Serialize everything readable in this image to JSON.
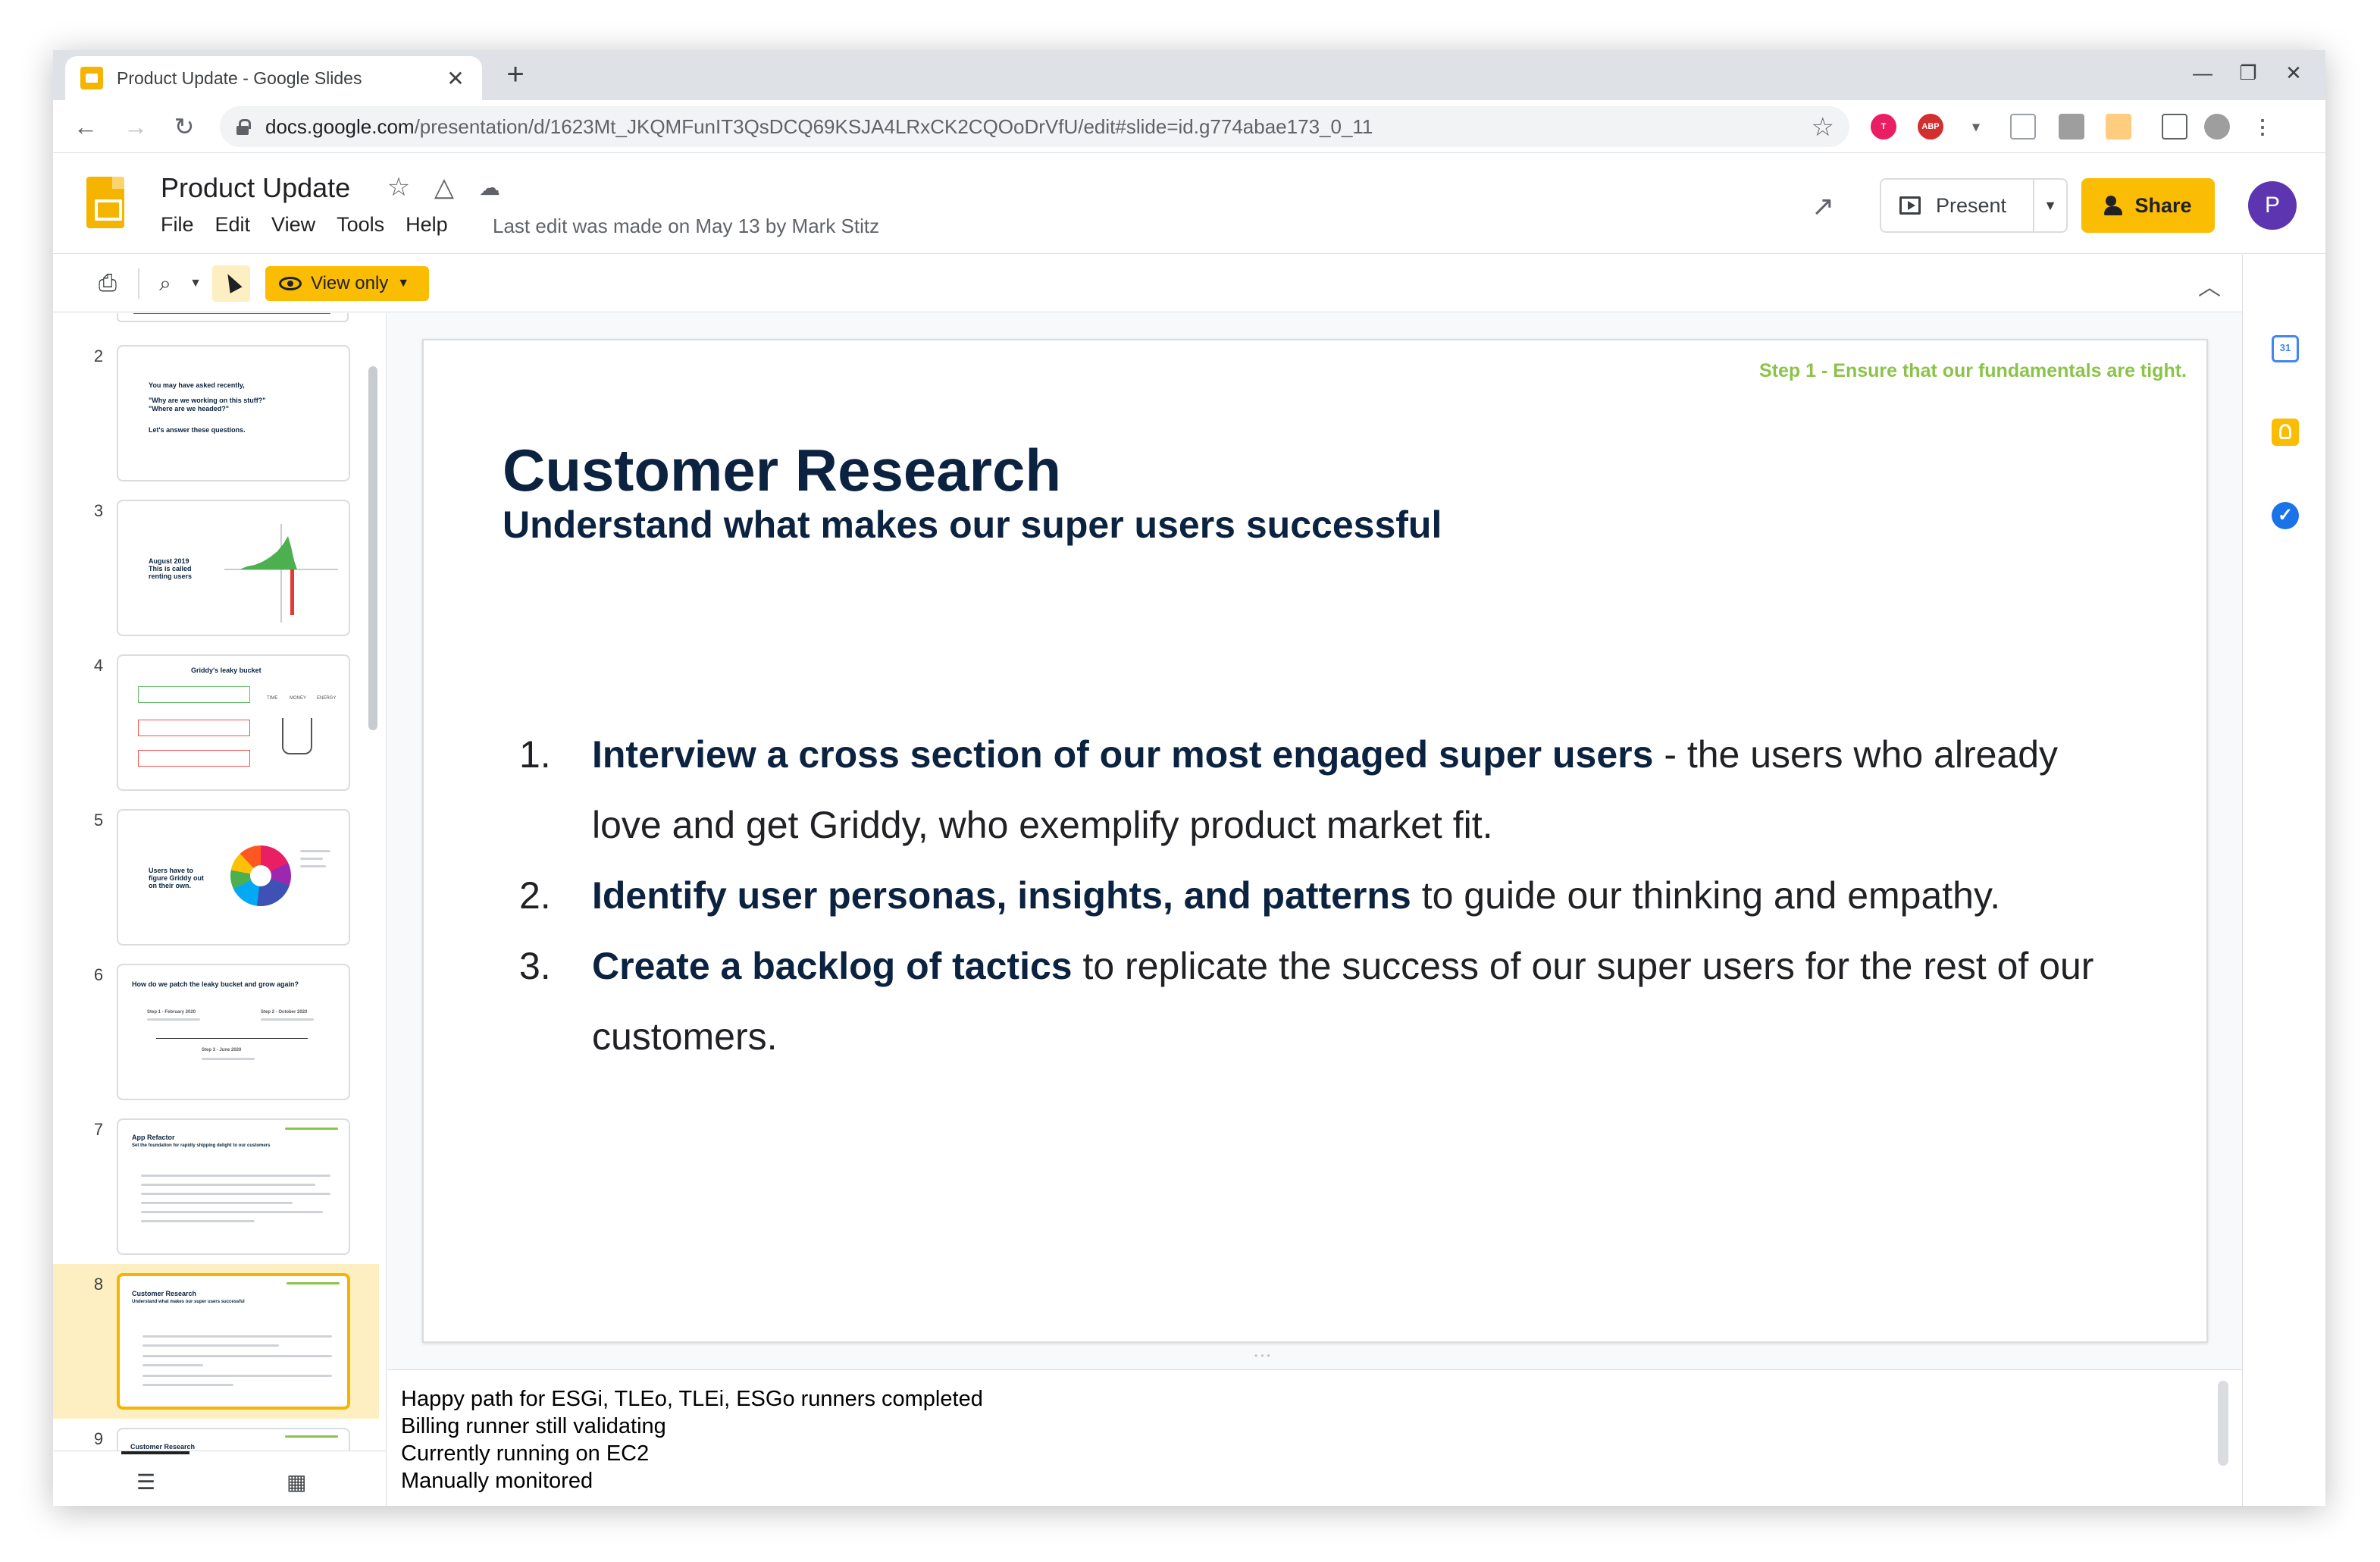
{
  "browser": {
    "tab_title": "Product Update - Google Slides",
    "tab_close": "✕",
    "new_tab": "+",
    "url_host": "docs.google.com",
    "url_path": "/presentation/d/1623Mt_JKQMFunIT3QsDCQ69KSJA4LRxCK2CQOoDrVfU/edit#slide=id.g774abae173_0_11"
  },
  "app": {
    "doc_title": "Product Update",
    "menu": [
      "File",
      "Edit",
      "View",
      "Tools",
      "Help"
    ],
    "last_edit": "Last edit was made on May 13 by Mark Stitz",
    "present_label": "Present",
    "share_label": "Share",
    "avatar_initial": "P"
  },
  "toolbar": {
    "view_only_label": "View only"
  },
  "side_panel": {
    "calendar_label": "31"
  },
  "filmstrip": {
    "slides": [
      {
        "num": "2",
        "lines": [
          "You may have asked recently,",
          "\"Why are we working on this stuff?\"",
          "\"Where are we headed?\"",
          "",
          "Let's answer these questions."
        ]
      },
      {
        "num": "3",
        "lines": [
          "August 2019",
          "This is called",
          "renting users"
        ]
      },
      {
        "num": "4",
        "title": "Griddy's leaky bucket",
        "labels": [
          "TIME",
          "MONEY",
          "ENERGY"
        ]
      },
      {
        "num": "5",
        "lines": [
          "Users have to",
          "figure Griddy out",
          "on their own."
        ]
      },
      {
        "num": "6",
        "title": "How do we patch the leaky bucket and grow again?",
        "steps": [
          "Step 1 - February 2020",
          "Step 2 - October 2020",
          "Step 3 - June 2020"
        ]
      },
      {
        "num": "7",
        "title": "App Refactor",
        "subtitle": "Set the foundation for rapidly shipping delight to our customers"
      },
      {
        "num": "8",
        "title": "Customer Research",
        "subtitle": "Understand what makes our super users successful"
      },
      {
        "num": "9",
        "title": "Customer Research"
      }
    ]
  },
  "slide": {
    "step_label": "Step 1 - Ensure that our fundamentals are tight.",
    "title": "Customer Research",
    "subtitle": "Understand what makes our super users successful",
    "items": [
      {
        "num": "1.",
        "bold": "Interview a cross section of our most engaged super users",
        "rest": " - the users who already love and get Griddy, who exemplify product market fit."
      },
      {
        "num": "2.",
        "bold": "Identify user personas, insights, and patterns",
        "rest": " to guide our thinking and empathy."
      },
      {
        "num": "3.",
        "bold": "Create a backlog of tactics",
        "rest": " to replicate the success of our super users for the rest of our customers."
      }
    ]
  },
  "notes": [
    "Happy path for ESGi, TLEo, TLEi, ESGo runners completed",
    "Billing runner still validating",
    "Currently running on EC2",
    "Manually monitored"
  ],
  "colors": {
    "accent_yellow": "#fbbc04",
    "step_green": "#8bc34a",
    "title_navy": "#0b2340",
    "avatar_purple": "#5e35b1"
  }
}
